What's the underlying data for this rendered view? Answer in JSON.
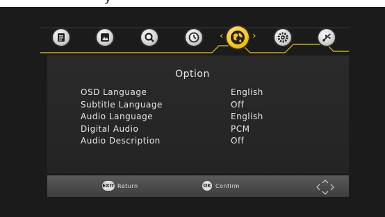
{
  "tabs": [
    {
      "name": "channel-manager",
      "icon": "list-icon"
    },
    {
      "name": "picture",
      "icon": "picture-icon"
    },
    {
      "name": "channel-search",
      "icon": "magnifier-icon"
    },
    {
      "name": "time",
      "icon": "clock-icon"
    },
    {
      "name": "option",
      "icon": "globe-icon",
      "active": true
    },
    {
      "name": "system",
      "icon": "gear-icon"
    },
    {
      "name": "usb",
      "icon": "usb-icon"
    }
  ],
  "page": {
    "title": "Option"
  },
  "options": [
    {
      "label": "OSD Language",
      "value": "English"
    },
    {
      "label": "Subtitle Language",
      "value": "Off"
    },
    {
      "label": "Audio Language",
      "value": "English"
    },
    {
      "label": "Digital Audio",
      "value": "PCM"
    },
    {
      "label": "Audio Description",
      "value": "Off"
    }
  ],
  "footer": {
    "exit_key": "EXIT",
    "return_label": "Return",
    "ok_key": "OK",
    "confirm_label": "Confirm"
  },
  "colors": {
    "accent": "#f5c518",
    "panel": "#2a2a2a",
    "footer": "#4a4a4a",
    "text": "#e8e8e8"
  }
}
